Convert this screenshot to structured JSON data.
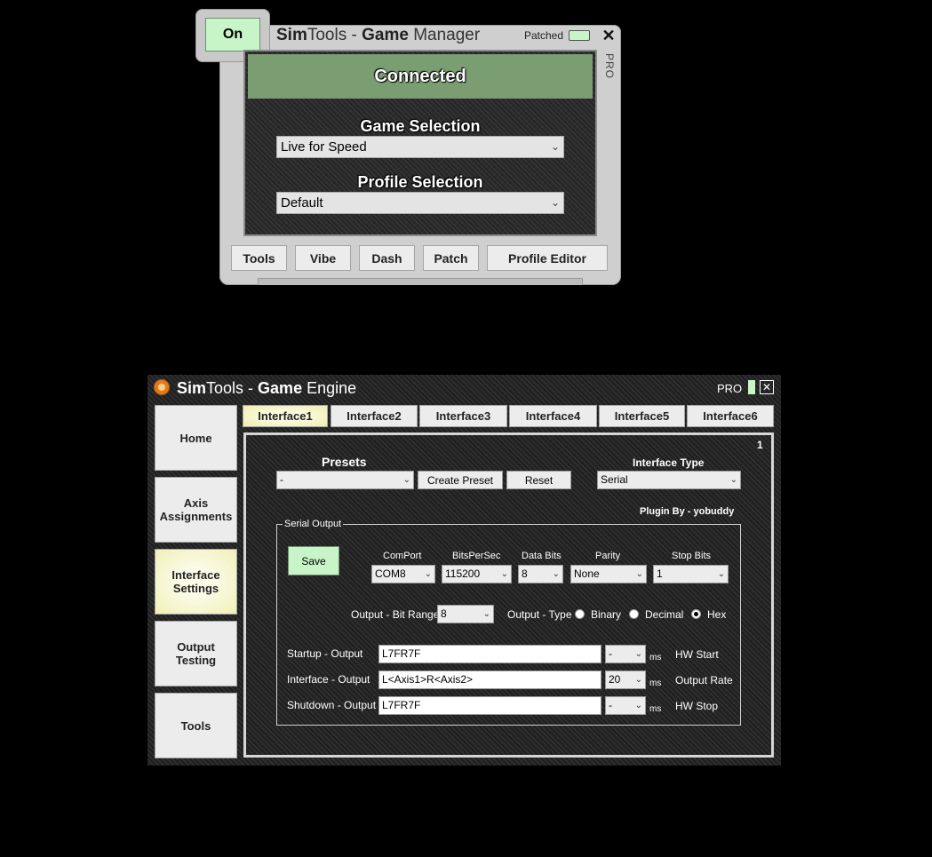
{
  "game_manager": {
    "on_button": "On",
    "title": {
      "sim": "Sim",
      "tools": "Tools - ",
      "game": "Game",
      "rest": " Manager"
    },
    "patched_label": "Patched",
    "close_label": "✕",
    "pro_label": "PRO",
    "status": "Connected",
    "game_selection_label": "Game Selection",
    "game_selection_value": "Live for Speed",
    "profile_selection_label": "Profile Selection",
    "profile_selection_value": "Default",
    "buttons": [
      "Tools",
      "Vibe",
      "Dash",
      "Patch",
      "Profile Editor"
    ]
  },
  "game_engine": {
    "title": {
      "sim": "Sim",
      "tools": "Tools - ",
      "game": "Game",
      "rest": " Engine"
    },
    "pro_label": "PRO",
    "close_label": "✕",
    "nav": [
      {
        "label": "Home"
      },
      {
        "label": "Axis\nAssignments"
      },
      {
        "label": "Interface\nSettings"
      },
      {
        "label": "Output\nTesting"
      },
      {
        "label": "Tools"
      }
    ],
    "tabs": [
      "Interface1",
      "Interface2",
      "Interface3",
      "Interface4",
      "Interface5",
      "Interface6"
    ],
    "panel_number": "1",
    "presets_label": "Presets",
    "presets_value": "-",
    "create_preset": "Create Preset",
    "reset": "Reset",
    "interface_type_label": "Interface Type",
    "interface_type_value": "Serial",
    "plugin_by": "Plugin By - yobuddy",
    "serial_output_legend": "Serial Output",
    "save": "Save",
    "comport_label": "ComPort",
    "comport_value": "COM8",
    "bps_label": "BitsPerSec",
    "bps_value": "115200",
    "databits_label": "Data Bits",
    "databits_value": "8",
    "parity_label": "Parity",
    "parity_value": "None",
    "stopbits_label": "Stop Bits",
    "stopbits_value": "1",
    "bitrange_label": "Output - Bit Range",
    "bitrange_value": "8",
    "outtype_label": "Output - Type",
    "type_binary": "Binary",
    "type_decimal": "Decimal",
    "type_hex": "Hex",
    "selected_type": "Hex",
    "startup_label": "Startup - Output",
    "startup_value": "L7FR7F",
    "startup_ms_value": "-",
    "interface_label": "Interface - Output",
    "interface_value": "L<Axis1>R<Axis2>",
    "interface_ms_value": "20",
    "shutdown_label": "Shutdown - Output",
    "shutdown_value": "L7FR7F",
    "shutdown_ms_value": "-",
    "ms": "ms",
    "hw_start": "HW Start",
    "output_rate": "Output Rate",
    "hw_stop": "HW Stop"
  }
}
